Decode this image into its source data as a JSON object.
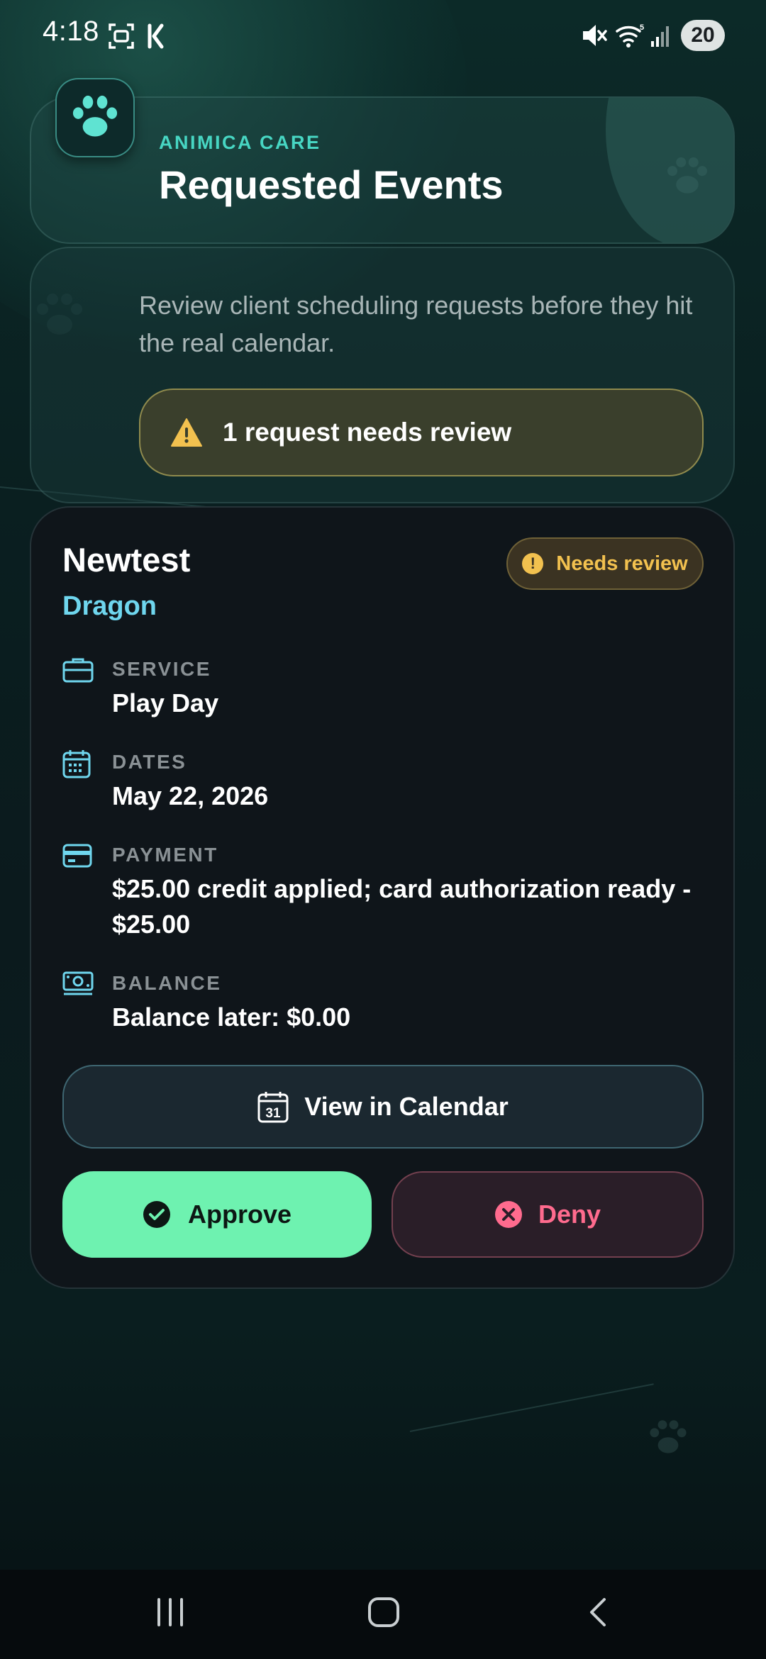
{
  "status_bar": {
    "time": "4:18",
    "battery": "20",
    "icons": [
      "screenshot-icon",
      "k-app-icon",
      "mute-icon",
      "wifi-icon",
      "signal-icon",
      "battery-icon"
    ]
  },
  "header": {
    "brand": "ANIMICA CARE",
    "title": "Requested Events",
    "logo_icon": "paw-icon"
  },
  "intro": {
    "description": "Review client scheduling requests before they hit the real calendar.",
    "alert": "1 request needs review",
    "alert_icon": "warning-icon"
  },
  "request": {
    "client_name": "Newtest",
    "pet_name": "Dragon",
    "status": "Needs review",
    "details": [
      {
        "label": "SERVICE",
        "value": "Play Day",
        "icon": "briefcase-icon"
      },
      {
        "label": "DATES",
        "value": "May 22, 2026",
        "icon": "calendar-icon"
      },
      {
        "label": "PAYMENT",
        "value": "$25.00 credit applied; card authorization ready - $25.00",
        "icon": "credit-card-icon"
      },
      {
        "label": "BALANCE",
        "value": "Balance later: $0.00",
        "icon": "cash-icon"
      }
    ],
    "view_calendar_label": "View in Calendar",
    "calendar_icon_day": "31",
    "approve_label": "Approve",
    "deny_label": "Deny"
  },
  "colors": {
    "accent_teal": "#47d6c3",
    "pet_name": "#6fd6ee",
    "approve": "#6ef2b0",
    "deny": "#ff6b8e",
    "warning": "#f2c14f"
  }
}
